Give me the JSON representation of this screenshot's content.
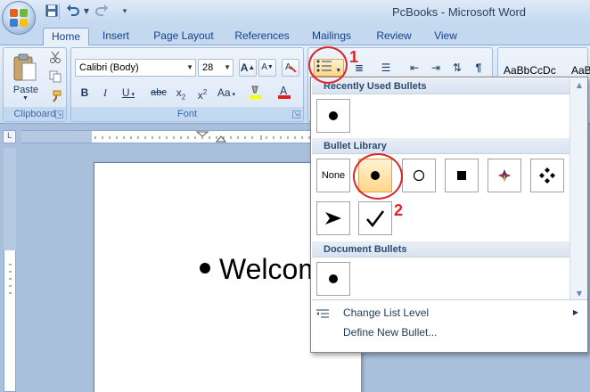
{
  "window": {
    "title": "PcBooks - Microsoft Word"
  },
  "quick_access": {
    "save_icon": "save-icon",
    "undo_icon": "undo-icon",
    "redo_icon": "redo-icon",
    "customize_icon": "customize-icon"
  },
  "tabs": [
    "Home",
    "Insert",
    "Page Layout",
    "References",
    "Mailings",
    "Review",
    "View"
  ],
  "ribbon": {
    "clipboard": {
      "label": "Clipboard",
      "paste_label": "Paste"
    },
    "font": {
      "label": "Font",
      "family": "Calibri (Body)",
      "size": "28"
    },
    "styles_preview": [
      "AaBbCcDc",
      "AaB"
    ]
  },
  "dropdown": {
    "recent_header": "Recently Used Bullets",
    "library_header": "Bullet Library",
    "document_header": "Document Bullets",
    "none_label": "None",
    "library_items": [
      "none",
      "filled-circle",
      "hollow-circle",
      "filled-square",
      "four-diamond",
      "four-diamonds",
      "arrowhead",
      "checkmark"
    ],
    "change_level_label": "Change List Level",
    "define_new_label": "Define New Bullet..."
  },
  "callouts": {
    "first": "1",
    "second": "2"
  },
  "document": {
    "line_text": "Welcom"
  },
  "colors": {
    "accent": "#15428b",
    "callout": "#d8262b",
    "highlight": "#ffd68a"
  }
}
